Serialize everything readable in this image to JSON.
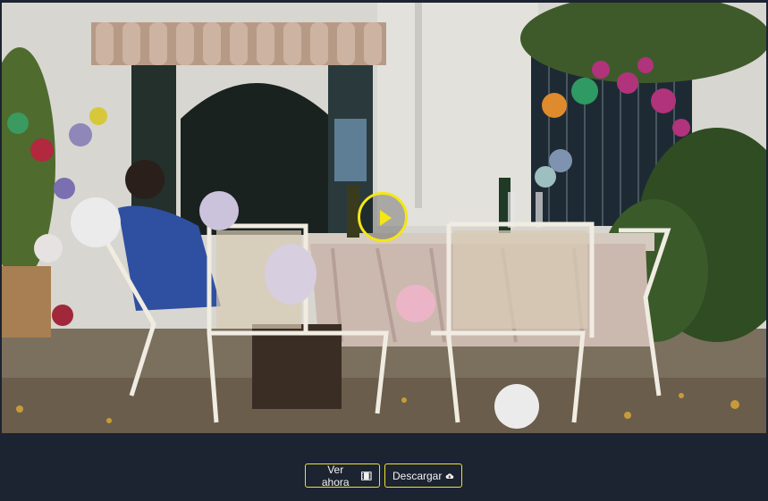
{
  "video": {
    "scene": "patio-party-aftermath",
    "play_icon": "play-icon",
    "accent_color": "#f5e614"
  },
  "actions": {
    "watch_label": "Ver ahora",
    "watch_icon": "film-icon",
    "download_label": "Descargar",
    "download_icon": "cloud-download-icon"
  },
  "colors": {
    "background": "#1c2331",
    "button_border": "#f0e428",
    "button_text": "#f1f1f1"
  }
}
